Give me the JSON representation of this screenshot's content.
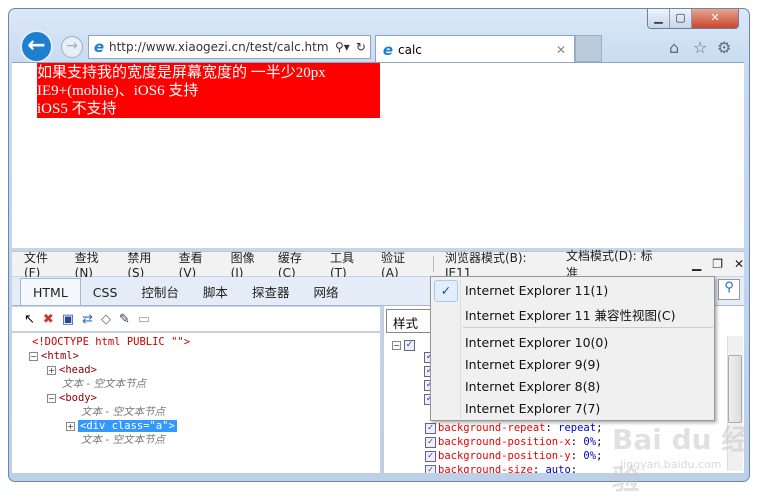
{
  "browser": {
    "url": "http://www.xiaogezi.cn/test/calc.htm",
    "tab_title": "calc"
  },
  "page": {
    "lines": [
      "如果支持我的宽度是屏幕宽度的 一半少20px",
      "IE9+(moblie)、iOS6 支持",
      "iOS5 不支持"
    ]
  },
  "devtools": {
    "menu": [
      "文件(F)",
      "查找(N)",
      "禁用(S)",
      "查看(V)",
      "图像(I)",
      "缓存(C)",
      "工具(T)",
      "验证(A)"
    ],
    "browser_mode": "浏览器模式(B): IE11",
    "doc_mode": "文档模式(D): 标准",
    "tabs": [
      "HTML",
      "CSS",
      "控制台",
      "脚本",
      "探查器",
      "网络"
    ],
    "tree": {
      "doctype": "<!DOCTYPE html PUBLIC \"\">",
      "html": "<html>",
      "head": "<head>",
      "empty": "文本 - 空文本节点",
      "body": "<body>",
      "div": "<div class=\"a\">"
    },
    "style_select": "样式",
    "props": [
      {
        "name": "background-repeat",
        "value": "repeat"
      },
      {
        "name": "background-position-x",
        "value": "0%"
      },
      {
        "name": "background-position-y",
        "value": "0%"
      },
      {
        "name": "background-size",
        "value": "auto"
      }
    ],
    "dropdown": [
      "Internet Explorer 11(1)",
      "Internet Explorer 11 兼容性视图(C)",
      "Internet Explorer 10(0)",
      "Internet Explorer 9(9)",
      "Internet Explorer 8(8)",
      "Internet Explorer 7(7)"
    ]
  },
  "watermark": {
    "brand": "Bai du 经验",
    "url": "jingyan.baidu.com"
  }
}
